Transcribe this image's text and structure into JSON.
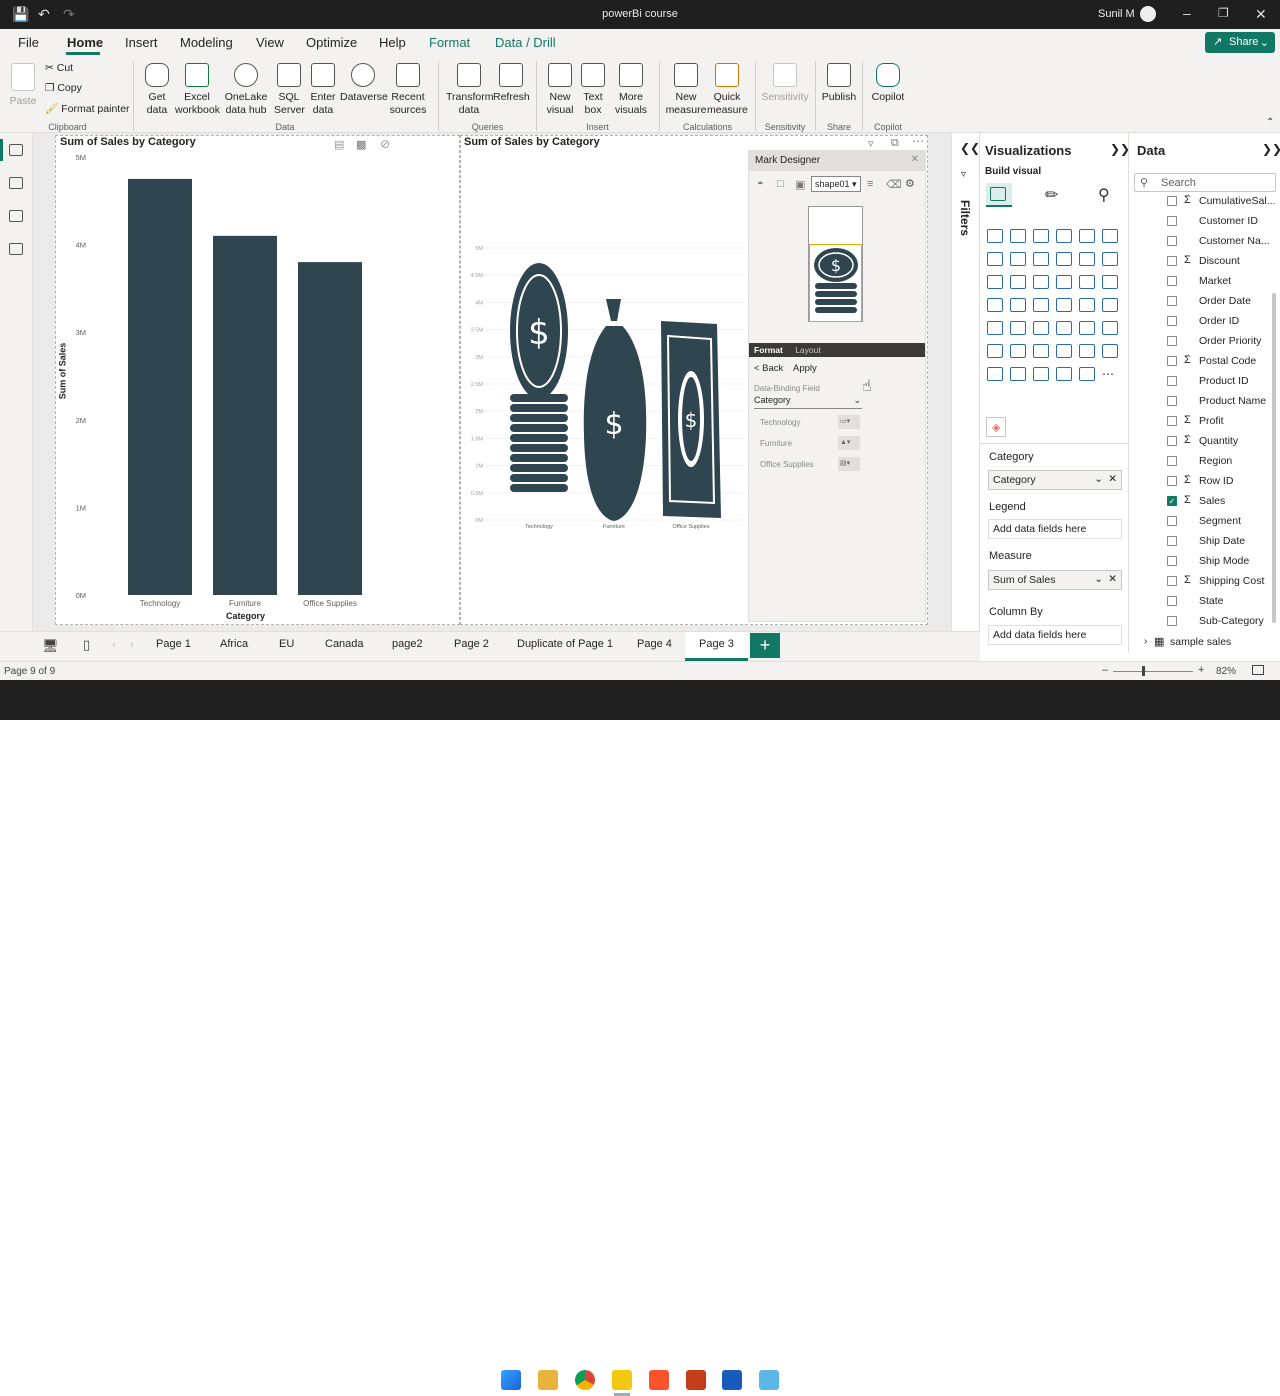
{
  "window": {
    "title": "powerBi course",
    "user": "Sunil M"
  },
  "menu": {
    "items": [
      "File",
      "Home",
      "Insert",
      "Modeling",
      "View",
      "Optimize",
      "Help",
      "Format",
      "Data / Drill"
    ],
    "share": "Share"
  },
  "ribbon": {
    "clipboard": {
      "paste": "Paste",
      "cut": "Cut",
      "copy": "Copy",
      "format_painter": "Format painter",
      "group": "Clipboard"
    },
    "data": {
      "get_data": "Get\ndata",
      "excel": "Excel\nworkbook",
      "onelake": "OneLake\ndata hub",
      "sql": "SQL\nServer",
      "enter": "Enter\ndata",
      "dataverse": "Dataverse",
      "recent": "Recent\nsources",
      "group": "Data"
    },
    "queries": {
      "transform": "Transform\ndata",
      "refresh": "Refresh",
      "group": "Queries"
    },
    "insert": {
      "new_visual": "New\nvisual",
      "text_box": "Text\nbox",
      "more_visuals": "More\nvisuals",
      "group": "Insert"
    },
    "calculations": {
      "new_measure": "New\nmeasure",
      "quick_measure": "Quick\nmeasure",
      "group": "Calculations"
    },
    "sensitivity": {
      "label": "Sensitivity",
      "group": "Sensitivity"
    },
    "share": {
      "publish": "Publish",
      "group": "Share"
    },
    "copilot": {
      "label": "Copilot",
      "group": "Copilot"
    }
  },
  "visual1": {
    "title": "Sum of Sales by Category",
    "ylabel": "Sum of Sales",
    "xlabel": "Category"
  },
  "visual2": {
    "title": "Sum of Sales by Category"
  },
  "chart_data": [
    {
      "type": "bar",
      "title": "Sum of Sales by Category",
      "xlabel": "Category",
      "ylabel": "Sum of Sales",
      "categories": [
        "Technology",
        "Furniture",
        "Office Supplies"
      ],
      "values": [
        4.75,
        4.1,
        3.8
      ],
      "unit": "M",
      "ylim": [
        0,
        5
      ],
      "yticks": [
        "0M",
        "1M",
        "2M",
        "3M",
        "4M",
        "5M"
      ],
      "grid": false
    },
    {
      "type": "bar",
      "title": "Sum of Sales by Category",
      "categories": [
        "Technology",
        "Furniture",
        "Office Supplies"
      ],
      "yticks": [
        "0M",
        "0.5M",
        "1M",
        "1.5M",
        "2M",
        "2.5M",
        "3M",
        "3.5M",
        "4M",
        "4.5M",
        "5M"
      ]
    }
  ],
  "mark_designer": {
    "title": "Mark Designer",
    "shape": "shape01",
    "tab_format": "Format",
    "tab_layout": "Layout",
    "back": "< Back",
    "apply": "Apply",
    "binding_label": "Data-Binding Field",
    "binding_value": "Category",
    "rows": [
      "Technology",
      "Furniture",
      "Office Supplies"
    ]
  },
  "filters": {
    "label": "Filters"
  },
  "visualizations": {
    "title": "Visualizations",
    "build": "Build visual",
    "wells": [
      {
        "label": "Category",
        "value": "Category"
      },
      {
        "label": "Legend",
        "placeholder": "Add data fields here"
      },
      {
        "label": "Measure",
        "value": "Sum of Sales"
      },
      {
        "label": "Column By",
        "placeholder": "Add data fields here"
      }
    ]
  },
  "data_pane": {
    "title": "Data",
    "search_placeholder": "Search",
    "fields": [
      {
        "name": "CumulativeSal...",
        "sigma": true,
        "checked": false
      },
      {
        "name": "Customer ID",
        "sigma": false,
        "checked": false
      },
      {
        "name": "Customer Na...",
        "sigma": false,
        "checked": false
      },
      {
        "name": "Discount",
        "sigma": true,
        "checked": false
      },
      {
        "name": "Market",
        "sigma": false,
        "checked": false
      },
      {
        "name": "Order Date",
        "sigma": false,
        "checked": false
      },
      {
        "name": "Order ID",
        "sigma": false,
        "checked": false
      },
      {
        "name": "Order Priority",
        "sigma": false,
        "checked": false
      },
      {
        "name": "Postal Code",
        "sigma": true,
        "checked": false
      },
      {
        "name": "Product ID",
        "sigma": false,
        "checked": false
      },
      {
        "name": "Product Name",
        "sigma": false,
        "checked": false
      },
      {
        "name": "Profit",
        "sigma": true,
        "checked": false
      },
      {
        "name": "Quantity",
        "sigma": true,
        "checked": false
      },
      {
        "name": "Region",
        "sigma": false,
        "checked": false
      },
      {
        "name": "Row ID",
        "sigma": true,
        "checked": false
      },
      {
        "name": "Sales",
        "sigma": true,
        "checked": true
      },
      {
        "name": "Segment",
        "sigma": false,
        "checked": false
      },
      {
        "name": "Ship Date",
        "sigma": false,
        "checked": false
      },
      {
        "name": "Ship Mode",
        "sigma": false,
        "checked": false
      },
      {
        "name": "Shipping Cost",
        "sigma": true,
        "checked": false
      },
      {
        "name": "State",
        "sigma": false,
        "checked": false
      },
      {
        "name": "Sub-Category",
        "sigma": false,
        "checked": false
      }
    ],
    "table": "sample sales"
  },
  "tabs": [
    "Page 1",
    "Africa",
    "EU",
    "Canada",
    "page2",
    "Page 2",
    "Duplicate of Page 1",
    "Page 4",
    "Page 3"
  ],
  "active_tab": "Page 3",
  "status": {
    "page": "Page 9 of 9",
    "zoom": "82%"
  },
  "colors": {
    "accent": "#117865",
    "bar": "#2f4550"
  }
}
